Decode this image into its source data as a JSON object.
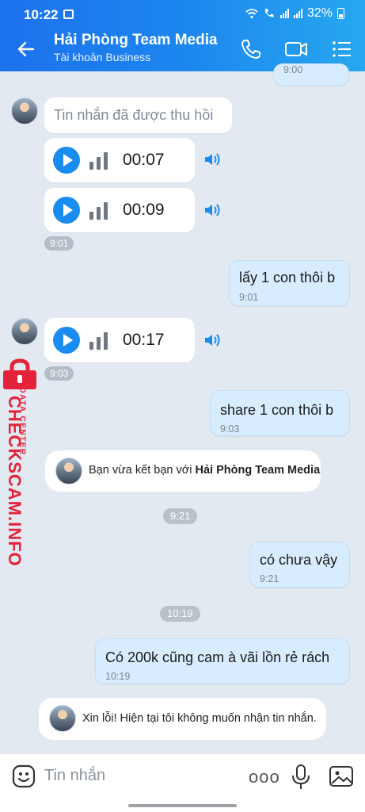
{
  "status_bar": {
    "time": "10:22",
    "battery": "32%"
  },
  "header": {
    "title": "Hải Phòng Team Media",
    "subtitle": "Tài khoản Business"
  },
  "messages": {
    "top_time": "9:00",
    "recalled": "Tin nhắn đã được thu hồi",
    "voice1": "00:07",
    "voice2": "00:09",
    "group_time1": "9:01",
    "msg1": {
      "text": "lấy 1 con thôi b",
      "time": "9:01"
    },
    "voice3": "00:17",
    "group_time2": "9:03",
    "msg2": {
      "text": "share 1 con thôi b",
      "time": "9:03"
    },
    "friend_notice": {
      "prefix": "Bạn vừa kết bạn với ",
      "name": "Hải Phòng Team Media"
    },
    "divider1": "9:21",
    "msg3": {
      "text": "có chưa vậy",
      "time": "9:21"
    },
    "divider2": "10:19",
    "msg4": {
      "text": "Có 200k cũng cam à vãi lồn rẻ rách",
      "time": "10:19"
    },
    "auto_reply": "Xin lỗi! Hiện tại tôi không muốn nhận tin nhắn."
  },
  "watermark": {
    "main": "CHECKSCAM.INFO",
    "sub": "DATA CENTER"
  },
  "input": {
    "placeholder": "Tin nhắn",
    "more": "ooo"
  },
  "colors": {
    "header_start": "#1d71ee",
    "header_end": "#27a7ef",
    "accent": "#1a8cf0",
    "my_bubble": "#d8ecff",
    "watermark": "#e4233a"
  }
}
